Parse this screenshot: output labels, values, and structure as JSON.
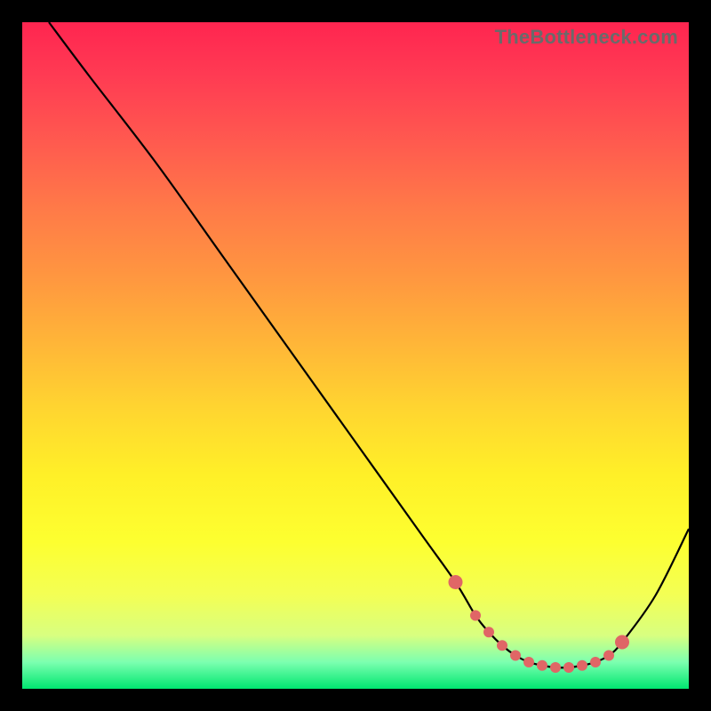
{
  "attribution": "TheBottleneck.com",
  "colors": {
    "background": "#000000",
    "gradient_top": "#ff2550",
    "gradient_bottom": "#00e770",
    "curve": "#000000",
    "marker": "#e06666"
  },
  "chart_data": {
    "type": "line",
    "title": "",
    "xlabel": "",
    "ylabel": "",
    "xlim": [
      0,
      100
    ],
    "ylim": [
      0,
      100
    ],
    "series": [
      {
        "name": "bottleneck-curve",
        "x": [
          4,
          10,
          20,
          30,
          40,
          50,
          60,
          65,
          68,
          70,
          72,
          74,
          76,
          78,
          80,
          82,
          84,
          86,
          88,
          90,
          95,
          100
        ],
        "y": [
          100,
          92,
          79,
          65,
          51,
          37,
          23,
          16,
          11,
          8.5,
          6.5,
          5,
          4,
          3.5,
          3.2,
          3.2,
          3.5,
          4,
          5,
          7,
          14,
          24
        ]
      }
    ],
    "markers": {
      "name": "highlighted-range",
      "x": [
        65,
        68,
        70,
        72,
        74,
        76,
        78,
        80,
        82,
        84,
        86,
        88,
        90
      ],
      "y": [
        16,
        11,
        8.5,
        6.5,
        5,
        4,
        3.5,
        3.2,
        3.2,
        3.5,
        4,
        5,
        7
      ]
    }
  }
}
